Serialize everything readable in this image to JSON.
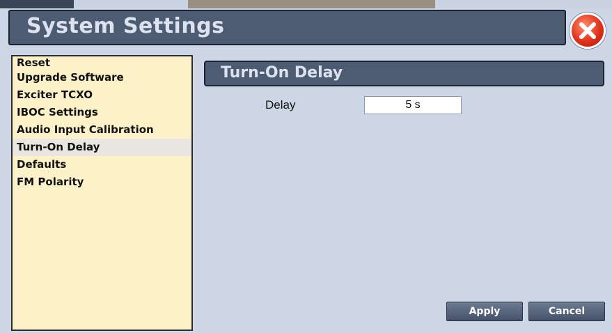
{
  "window": {
    "title": "System Settings",
    "close_icon": "close-x-icon"
  },
  "sidebar": {
    "items": [
      {
        "label": "Reset",
        "active": false
      },
      {
        "label": "Upgrade Software",
        "active": false
      },
      {
        "label": "Exciter TCXO",
        "active": false
      },
      {
        "label": "IBOC Settings",
        "active": false
      },
      {
        "label": "Audio Input Calibration",
        "active": false
      },
      {
        "label": "Turn-On Delay",
        "active": true
      },
      {
        "label": "Defaults",
        "active": false
      },
      {
        "label": "FM Polarity",
        "active": false
      }
    ]
  },
  "main": {
    "section_title": "Turn-On Delay",
    "delay_label": "Delay",
    "delay_value": "5 s"
  },
  "buttons": {
    "apply_label": "Apply",
    "cancel_label": "Cancel"
  },
  "colors": {
    "background": "#cdd6e4",
    "title_bar": "#4d5c73",
    "sidebar_bg": "#fdf1c9",
    "close_red": "#e0321b"
  }
}
